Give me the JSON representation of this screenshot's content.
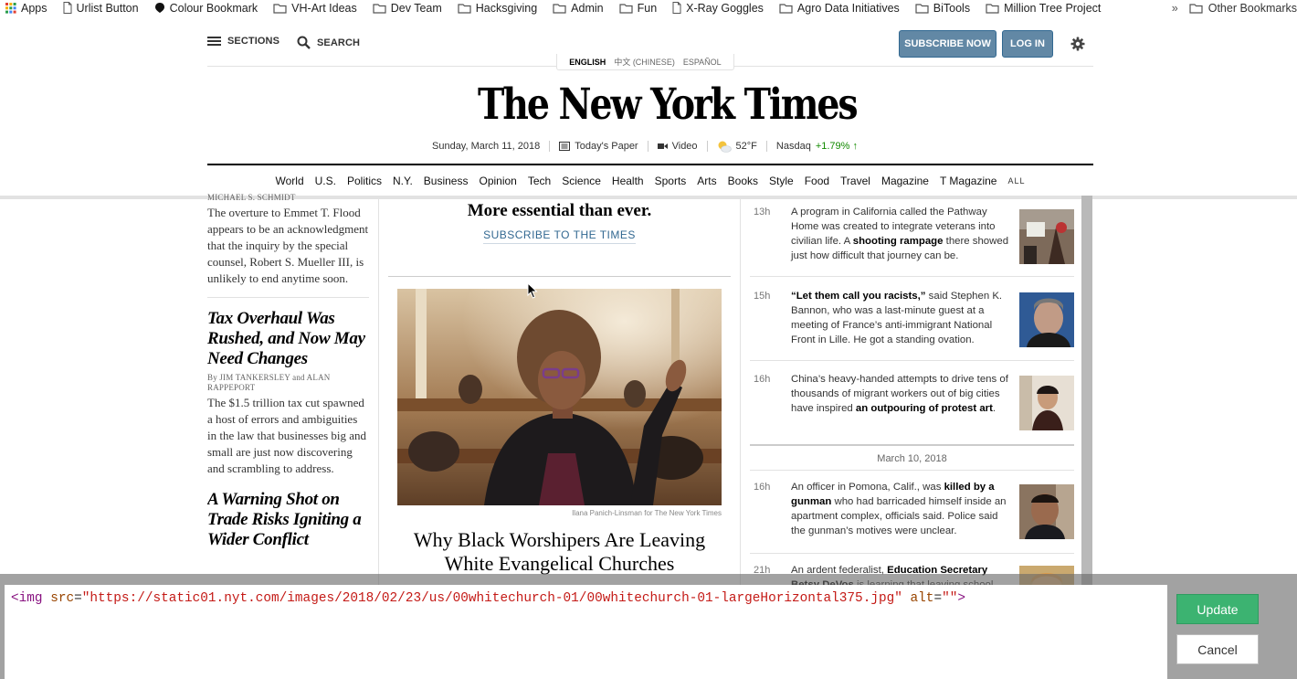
{
  "bookmarks": {
    "items": [
      {
        "label": "Apps",
        "icon": "apps-grid-icon"
      },
      {
        "label": "Urlist Button",
        "icon": "page-icon"
      },
      {
        "label": "Colour Bookmark",
        "icon": "bookmark-dot-icon"
      },
      {
        "label": "VH-Art Ideas",
        "icon": "folder-icon"
      },
      {
        "label": "Dev Team",
        "icon": "folder-icon"
      },
      {
        "label": "Hacksgiving",
        "icon": "folder-icon"
      },
      {
        "label": "Admin",
        "icon": "folder-icon"
      },
      {
        "label": "Fun",
        "icon": "folder-icon"
      },
      {
        "label": "X-Ray Goggles",
        "icon": "page-icon"
      },
      {
        "label": "Agro Data Initiatives",
        "icon": "folder-icon"
      },
      {
        "label": "BiTools",
        "icon": "folder-icon"
      },
      {
        "label": "Million Tree Project",
        "icon": "folder-icon"
      }
    ],
    "more": "»",
    "other": "Other Bookmarks"
  },
  "header": {
    "sections_label": "SECTIONS",
    "search_label": "SEARCH",
    "subscribe_label": "SUBSCRIBE NOW",
    "login_label": "LOG IN",
    "languages": [
      "ENGLISH",
      "中文 (CHINESE)",
      "ESPAÑOL"
    ],
    "logo_text": "The New York Times",
    "date": "Sunday, March 11, 2018",
    "todays_paper": "Today's Paper",
    "video": "Video",
    "weather": "52°F",
    "nasdaq_label": "Nasdaq",
    "nasdaq_change": "+1.79% ↑"
  },
  "sections_nav": [
    "World",
    "U.S.",
    "Politics",
    "N.Y.",
    "Business",
    "Opinion",
    "Tech",
    "Science",
    "Health",
    "Sports",
    "Arts",
    "Books",
    "Style",
    "Food",
    "Travel",
    "Magazine",
    "T Magazine"
  ],
  "sections_all": "ALL",
  "left_column": {
    "byline1": "MICHAEL S. SCHMIDT",
    "summary1": "The overture to Emmet T. Flood appears to be an acknowledgment that the inquiry by the special counsel, Robert S. Mueller III, is unlikely to end anytime soon.",
    "headline2": "Tax Overhaul Was Rushed, and Now May Need Changes",
    "byline2": "By JIM TANKERSLEY and ALAN RAPPEPORT",
    "summary2": "The $1.5 trillion tax cut spawned a host of errors and ambiguities in the law that businesses big and small are just now discovering and scrambling to address.",
    "headline3": "A Warning Shot on Trade Risks Igniting a Wider Conflict"
  },
  "center_column": {
    "promo_title": "More essential than ever.",
    "promo_link": "SUBSCRIBE TO THE TIMES",
    "photo_credit": "Ilana Panich-Linsman for The New York Times",
    "headline": "Why Black Worshipers Are Leaving White Evangelical Churches"
  },
  "briefings": [
    {
      "time": "13h",
      "parts": [
        [
          "A program in California called the Pathway Home was created to integrate veterans into civilian life. A ",
          false
        ],
        [
          "shooting rampage",
          true
        ],
        [
          " there showed just how difficult that journey can be.",
          false
        ]
      ]
    },
    {
      "time": "15h",
      "parts": [
        [
          "“Let them call you racists,”",
          true
        ],
        [
          " said Stephen K. Bannon, who was a last-minute guest at a meeting of France’s anti-immigrant National Front in Lille. He got a standing ovation.",
          false
        ]
      ]
    },
    {
      "time": "16h",
      "parts": [
        [
          "China’s heavy-handed attempts to drive tens of thousands of migrant workers out of big cities have inspired ",
          false
        ],
        [
          "an outpouring of protest art",
          true
        ],
        [
          ".",
          false
        ]
      ]
    },
    {
      "time": "16h",
      "parts": [
        [
          "An officer in Pomona, Calif., was ",
          false
        ],
        [
          "killed by a gunman",
          true
        ],
        [
          " who had barricaded himself inside an apartment complex, officials said. Police said the gunman’s motives were unclear.",
          false
        ]
      ]
    },
    {
      "time": "21h",
      "parts": [
        [
          "An ardent federalist, ",
          false
        ],
        [
          "Education Secretary Betsy DeVos",
          true
        ],
        [
          " is learning that leaving school",
          false
        ]
      ]
    }
  ],
  "briefing_date": "March 10, 2018",
  "editor": {
    "tag_open": "<img",
    "attr1": "src",
    "val1": "\"https://static01.nyt.com/images/2018/02/23/us/00whitechurch-01/00whitechurch-01-largeHorizontal375.jpg\"",
    "attr2": "alt",
    "val2": "\"\"",
    "tag_close": ">",
    "eq": "="
  },
  "buttons": {
    "update": "Update",
    "cancel": "Cancel"
  },
  "colors": {
    "accent_blue": "#6288a5",
    "link_blue": "#326891",
    "update_green": "#3cb371",
    "nasdaq_up": "#128a00"
  }
}
